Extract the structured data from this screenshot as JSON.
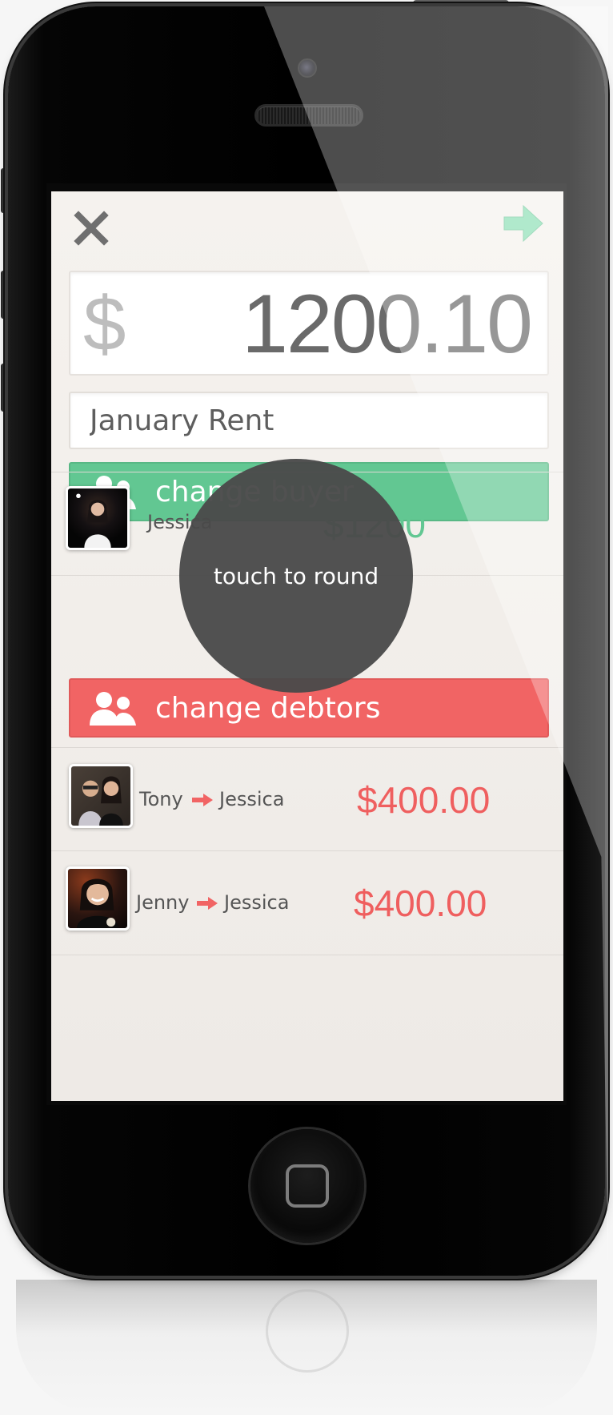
{
  "header": {
    "close_icon": "close-x-icon",
    "next_icon": "arrow-right-icon"
  },
  "amount": {
    "currency": "$",
    "value": "1200.10"
  },
  "description": {
    "value": "January Rent"
  },
  "buyer": {
    "button_label": "change buyer",
    "icon": "people-icon",
    "color": "#62c792",
    "person": {
      "name": "Jessica",
      "amount": "$1200"
    }
  },
  "tooltip": {
    "label": "touch to round"
  },
  "debtors": {
    "button_label": "change debtors",
    "icon": "people-icon",
    "color": "#f16464",
    "items": [
      {
        "from": "Tony",
        "to": "Jessica",
        "amount": "$400.00"
      },
      {
        "from": "Jenny",
        "to": "Jessica",
        "amount": "$400.00"
      }
    ]
  }
}
